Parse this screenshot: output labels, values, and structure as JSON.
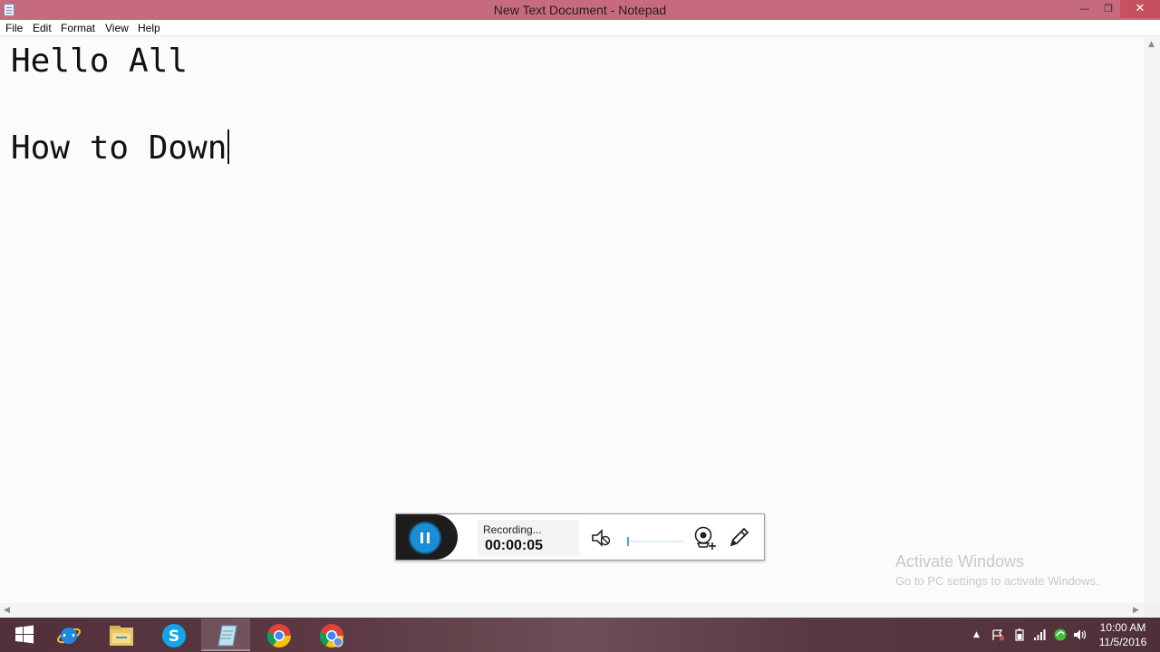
{
  "window": {
    "title": "New Text Document - Notepad",
    "minimize_glyph": "—",
    "maximize_glyph": "❐",
    "close_glyph": "✕"
  },
  "menu": {
    "items": [
      "File",
      "Edit",
      "Format",
      "View",
      "Help"
    ]
  },
  "editor": {
    "lines": [
      "Hello All",
      "",
      "How to Down"
    ]
  },
  "recorder": {
    "status": "Recording...",
    "elapsed": "00:00:05",
    "volume_level": 0.03
  },
  "watermark": {
    "title": "Activate Windows",
    "subtitle": "Go to PC settings to activate Windows."
  },
  "taskbar": {
    "apps": [
      {
        "icon": "windows-start-icon"
      },
      {
        "icon": "internet-explorer-icon"
      },
      {
        "icon": "file-explorer-icon"
      },
      {
        "icon": "skype-icon"
      },
      {
        "icon": "notepad-icon",
        "active": true
      },
      {
        "icon": "chrome-icon"
      },
      {
        "icon": "chrome-profile-icon"
      }
    ],
    "tray": {
      "show_hidden_glyph": "▲",
      "time": "10:00 AM",
      "date": "11/5/2016"
    }
  },
  "colors": {
    "titlebar": "#c56b7d",
    "close_button": "#c7505e",
    "pause_button": "#1a8fd6"
  }
}
